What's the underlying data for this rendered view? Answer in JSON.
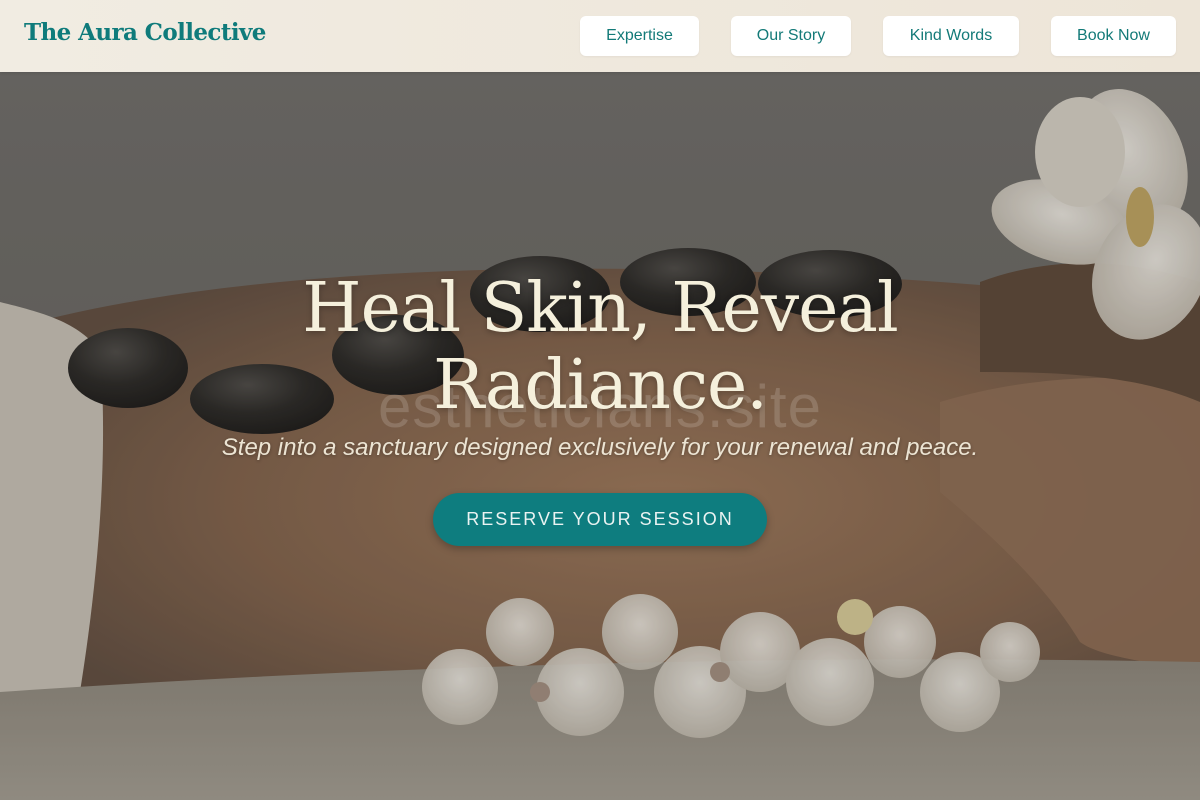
{
  "header": {
    "brand": "The Aura Collective",
    "nav": [
      {
        "label": "Expertise"
      },
      {
        "label": "Our Story"
      },
      {
        "label": "Kind Words"
      },
      {
        "label": "Book Now"
      }
    ]
  },
  "hero": {
    "title_line1": "Heal Skin, Reveal",
    "title_line2": "Radiance.",
    "watermark": "estheticians.site",
    "subtitle": "Step into a sanctuary designed exclusively for your renewal and peace.",
    "cta_label": "RESERVE YOUR SESSION"
  },
  "colors": {
    "brand": "#0f7b7b",
    "header_bg": "#f1ece2",
    "cta_bg": "#0e7d7f",
    "hero_text": "#f5f0dc"
  },
  "icons": {
    "hero_image": "hot-stone-massage-photo"
  }
}
